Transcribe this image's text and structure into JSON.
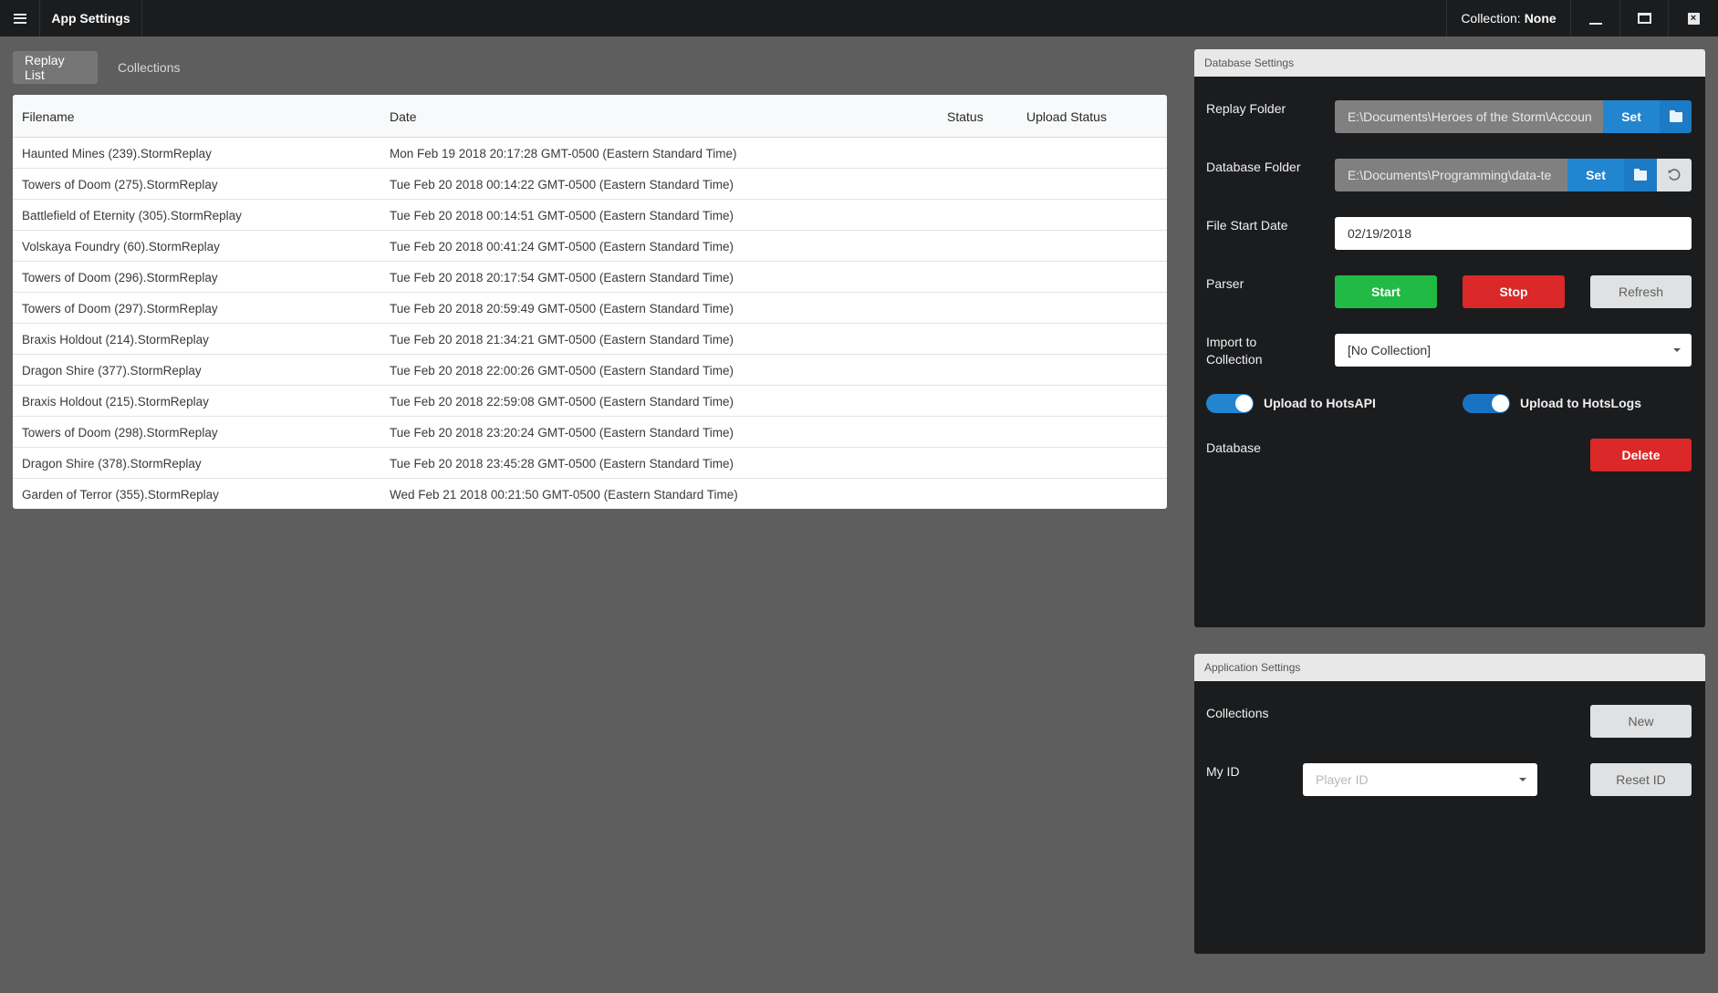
{
  "titlebar": {
    "title": "App Settings",
    "collection_label": "Collection:",
    "collection_value": "None",
    "close_glyph": "×"
  },
  "tabs": [
    {
      "label": "Replay List",
      "active": true
    },
    {
      "label": "Collections",
      "active": false
    }
  ],
  "table": {
    "columns": [
      "Filename",
      "Date",
      "Status",
      "Upload Status"
    ],
    "rows": [
      {
        "filename": "Haunted Mines (239).StormReplay",
        "date": "Mon Feb 19 2018 20:17:28 GMT-0500 (Eastern Standard Time)",
        "status": "",
        "upload_status": ""
      },
      {
        "filename": "Towers of Doom (275).StormReplay",
        "date": "Tue Feb 20 2018 00:14:22 GMT-0500 (Eastern Standard Time)",
        "status": "",
        "upload_status": ""
      },
      {
        "filename": "Battlefield of Eternity (305).StormReplay",
        "date": "Tue Feb 20 2018 00:14:51 GMT-0500 (Eastern Standard Time)",
        "status": "",
        "upload_status": ""
      },
      {
        "filename": "Volskaya Foundry (60).StormReplay",
        "date": "Tue Feb 20 2018 00:41:24 GMT-0500 (Eastern Standard Time)",
        "status": "",
        "upload_status": ""
      },
      {
        "filename": "Towers of Doom (296).StormReplay",
        "date": "Tue Feb 20 2018 20:17:54 GMT-0500 (Eastern Standard Time)",
        "status": "",
        "upload_status": ""
      },
      {
        "filename": "Towers of Doom (297).StormReplay",
        "date": "Tue Feb 20 2018 20:59:49 GMT-0500 (Eastern Standard Time)",
        "status": "",
        "upload_status": ""
      },
      {
        "filename": "Braxis Holdout (214).StormReplay",
        "date": "Tue Feb 20 2018 21:34:21 GMT-0500 (Eastern Standard Time)",
        "status": "",
        "upload_status": ""
      },
      {
        "filename": "Dragon Shire (377).StormReplay",
        "date": "Tue Feb 20 2018 22:00:26 GMT-0500 (Eastern Standard Time)",
        "status": "",
        "upload_status": ""
      },
      {
        "filename": "Braxis Holdout (215).StormReplay",
        "date": "Tue Feb 20 2018 22:59:08 GMT-0500 (Eastern Standard Time)",
        "status": "",
        "upload_status": ""
      },
      {
        "filename": "Towers of Doom (298).StormReplay",
        "date": "Tue Feb 20 2018 23:20:24 GMT-0500 (Eastern Standard Time)",
        "status": "",
        "upload_status": ""
      },
      {
        "filename": "Dragon Shire (378).StormReplay",
        "date": "Tue Feb 20 2018 23:45:28 GMT-0500 (Eastern Standard Time)",
        "status": "",
        "upload_status": ""
      },
      {
        "filename": "Garden of Terror (355).StormReplay",
        "date": "Wed Feb 21 2018 00:21:50 GMT-0500 (Eastern Standard Time)",
        "status": "",
        "upload_status": ""
      }
    ]
  },
  "database_settings": {
    "header": "Database Settings",
    "replay_folder": {
      "label": "Replay Folder",
      "value": "E:\\Documents\\Heroes of the Storm\\Accoun",
      "set_label": "Set"
    },
    "database_folder": {
      "label": "Database Folder",
      "value": "E:\\Documents\\Programming\\data-te",
      "set_label": "Set"
    },
    "file_start_date": {
      "label": "File Start Date",
      "value": "02/19/2018"
    },
    "parser": {
      "label": "Parser",
      "start_label": "Start",
      "stop_label": "Stop",
      "refresh_label": "Refresh"
    },
    "import_collection": {
      "label_line1": "Import to",
      "label_line2": "Collection",
      "selected": "[No Collection]"
    },
    "upload_hotsapi": {
      "label": "Upload to HotsAPI",
      "enabled": true
    },
    "upload_hotslogs": {
      "label": "Upload to HotsLogs",
      "enabled": true
    },
    "database": {
      "label": "Database",
      "delete_label": "Delete"
    }
  },
  "application_settings": {
    "header": "Application Settings",
    "collections": {
      "label": "Collections",
      "new_label": "New"
    },
    "my_id": {
      "label": "My ID",
      "placeholder": "Player ID",
      "reset_label": "Reset ID"
    }
  },
  "colors": {
    "primary": "#2185d0",
    "positive": "#21ba45",
    "negative": "#db2828",
    "panel_bg": "#1b1c1e",
    "page_bg": "#5e5e5e"
  }
}
